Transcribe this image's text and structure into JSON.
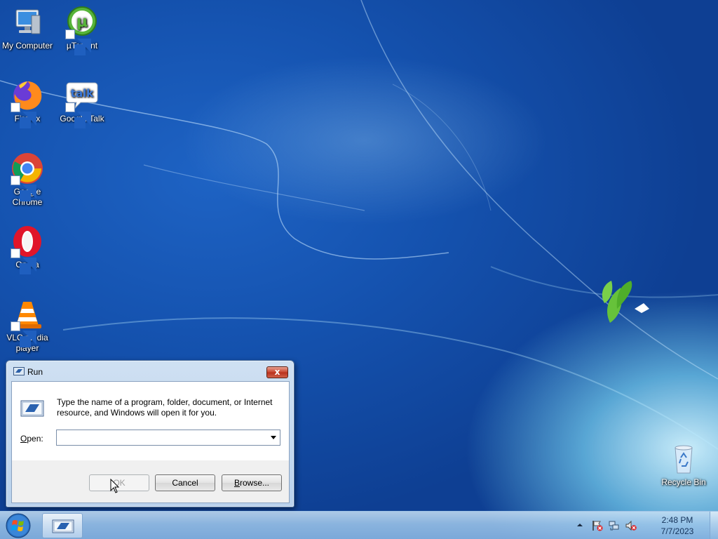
{
  "desktop": {
    "icons": [
      {
        "label": "My Computer"
      },
      {
        "label": "µTorrent"
      },
      {
        "label": "Firefox"
      },
      {
        "label": "Google Talk",
        "glyph": "talk"
      },
      {
        "label_line1": "Google",
        "label_line2": "Chrome"
      },
      {
        "label": "Opera"
      },
      {
        "label_line1": "VLC media",
        "label_line2": "player"
      },
      {
        "label": "Recycle Bin"
      }
    ]
  },
  "run_dialog": {
    "title": "Run",
    "close_glyph": "x",
    "description": "Type the name of a program, folder, document, or Internet resource, and Windows will open it for you.",
    "open_label_accel": "O",
    "open_label_rest": "pen:",
    "open_value": "",
    "ok_label": "OK",
    "cancel_label": "Cancel",
    "browse_label_accel": "B",
    "browse_label_rest": "rowse..."
  },
  "taskbar": {
    "clock_time": "2:48 PM",
    "clock_date": "7/7/2023"
  },
  "colors": {
    "desktop_blue": "#1553b0",
    "close_red": "#c8452f",
    "taskbar": "#a0c8eb"
  }
}
